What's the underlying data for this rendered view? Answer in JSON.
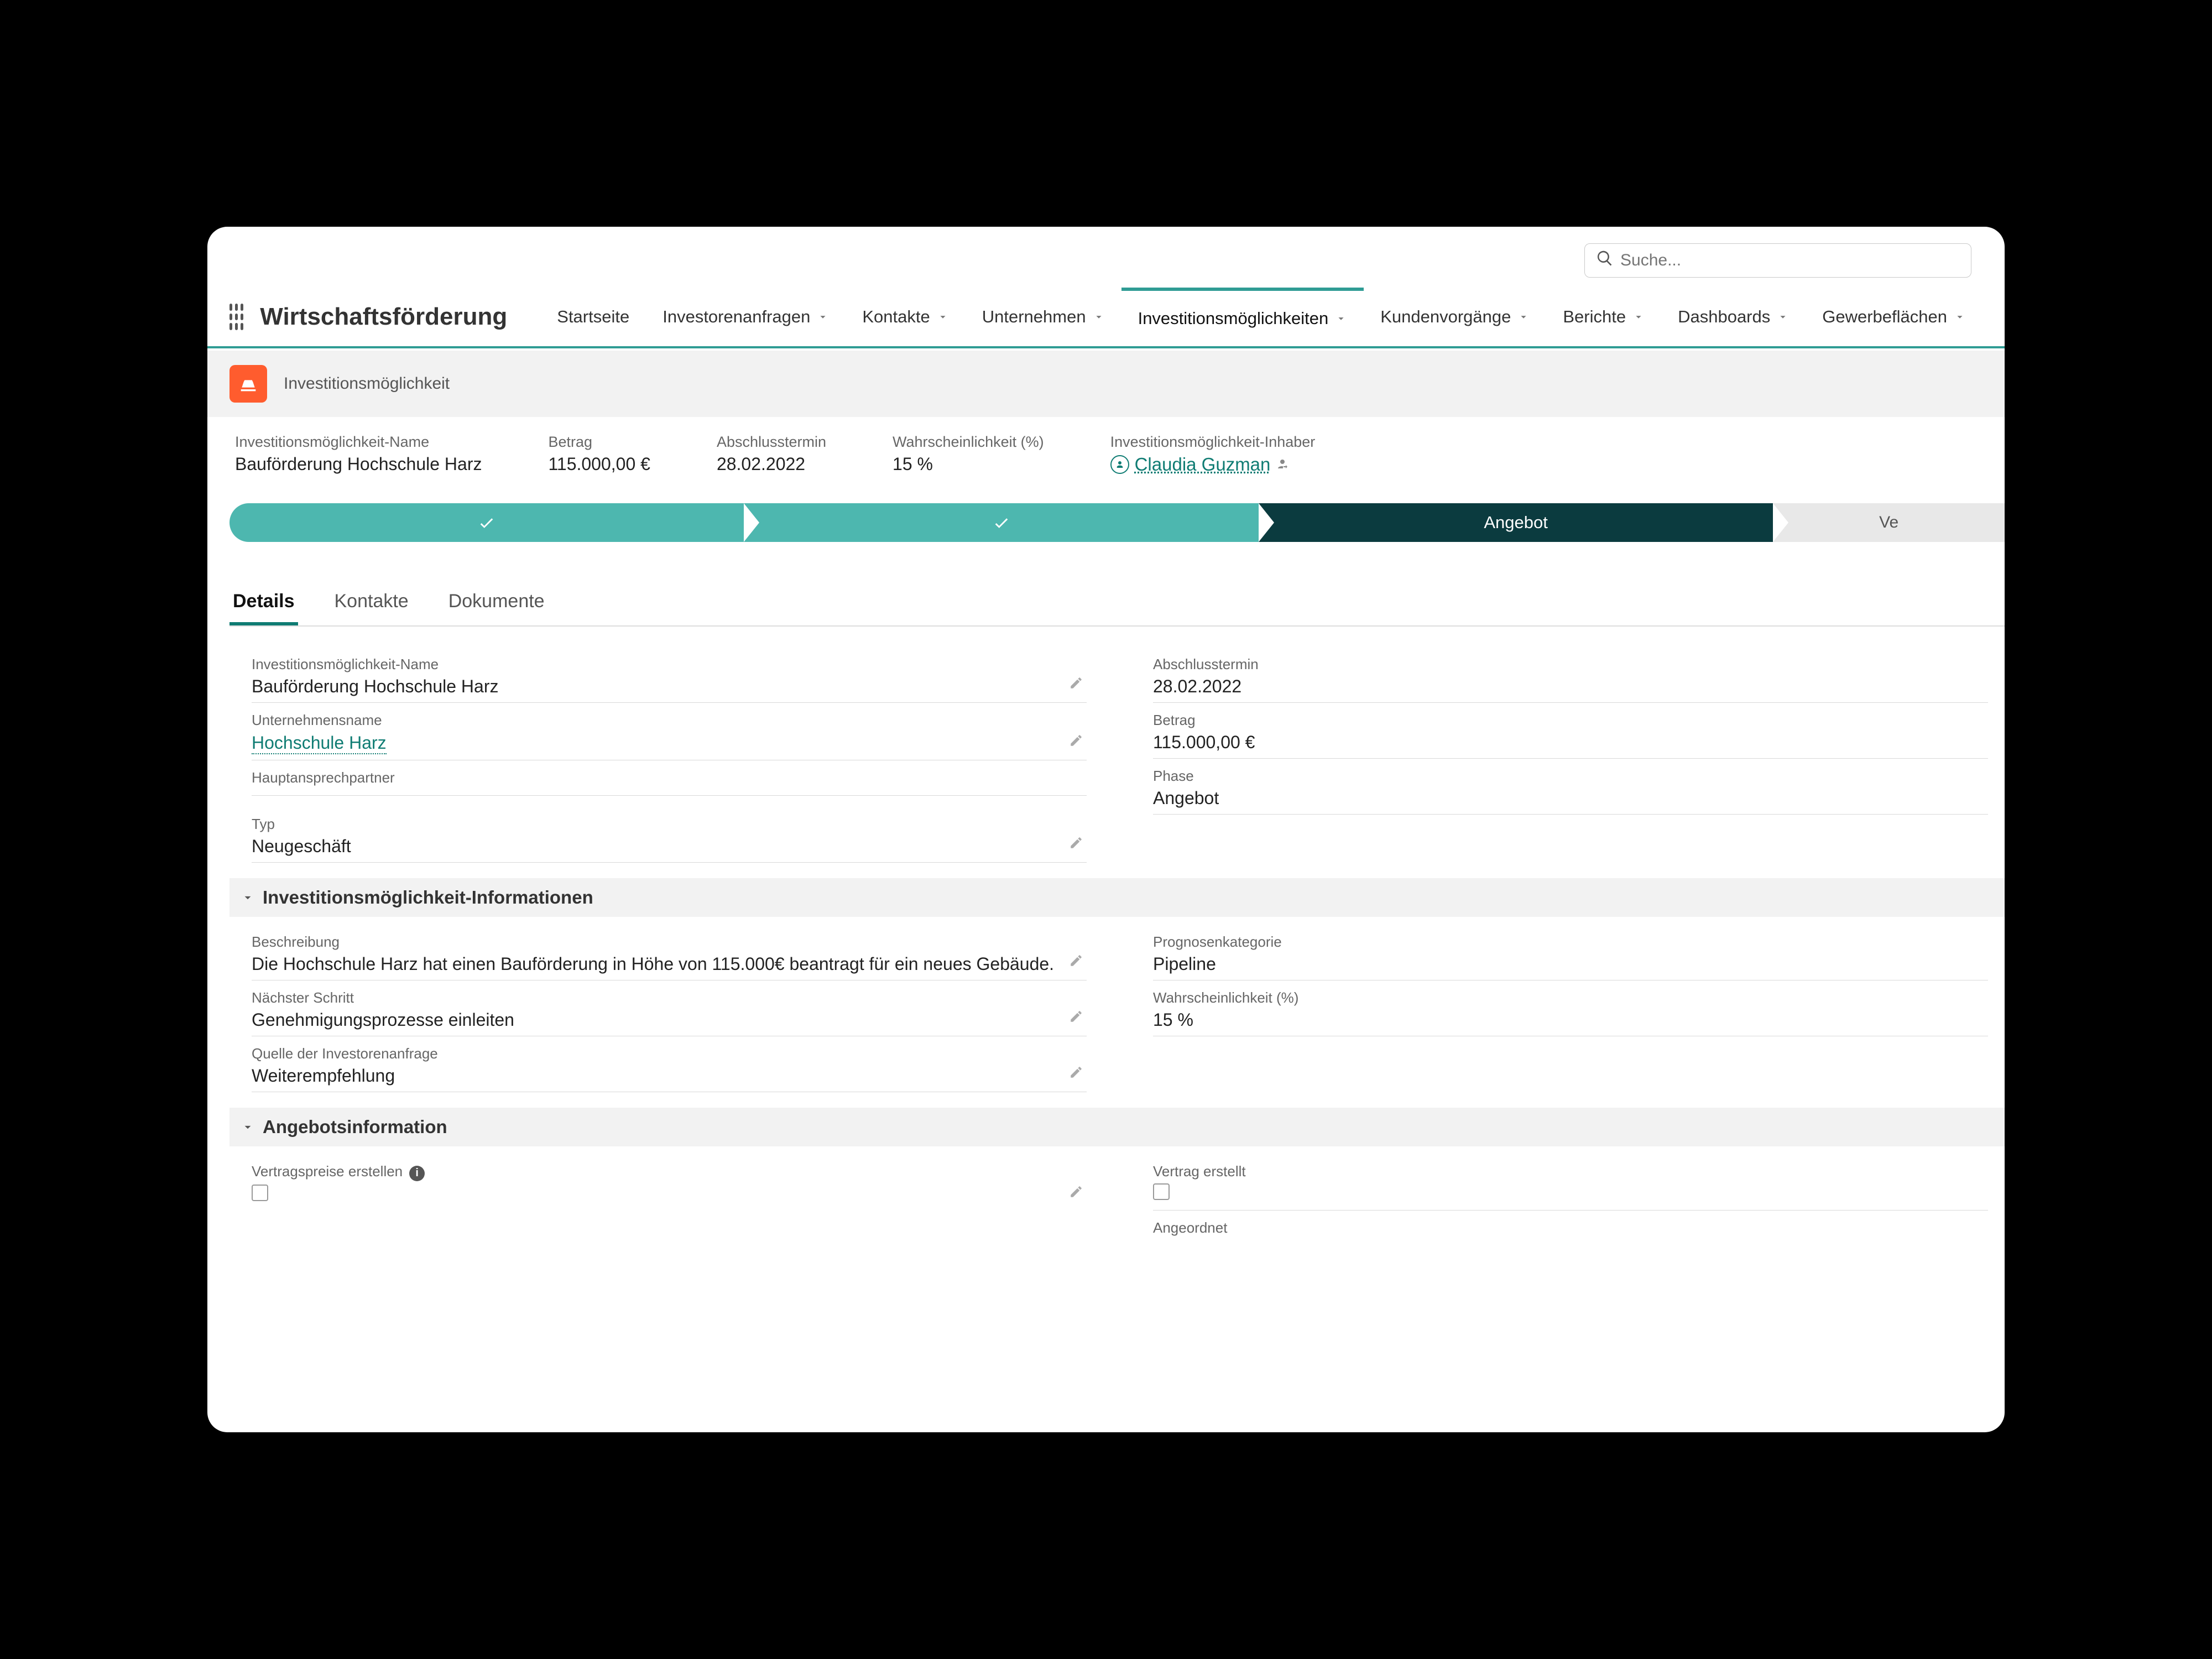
{
  "search": {
    "placeholder": "Suche..."
  },
  "app_name": "Wirtschaftsförderung",
  "nav": [
    {
      "label": "Startseite",
      "has_dropdown": false
    },
    {
      "label": "Investorenanfragen",
      "has_dropdown": true
    },
    {
      "label": "Kontakte",
      "has_dropdown": true
    },
    {
      "label": "Unternehmen",
      "has_dropdown": true
    },
    {
      "label": "Investitionsmöglichkeiten",
      "has_dropdown": true,
      "active": true
    },
    {
      "label": "Kundenvorgänge",
      "has_dropdown": true
    },
    {
      "label": "Berichte",
      "has_dropdown": true
    },
    {
      "label": "Dashboards",
      "has_dropdown": true
    },
    {
      "label": "Gewerbeflächen",
      "has_dropdown": true
    }
  ],
  "record": {
    "type_label": "Investitionsmöglichkeit"
  },
  "summary": {
    "name_label": "Investitionsmöglichkeit-Name",
    "name_value": "Bauförderung Hochschule Harz",
    "amount_label": "Betrag",
    "amount_value": "115.000,00 €",
    "close_label": "Abschlusstermin",
    "close_value": "28.02.2022",
    "prob_label": "Wahrscheinlichkeit (%)",
    "prob_value": "15 %",
    "owner_label": "Investitionsmöglichkeit-Inhaber",
    "owner_value": "Claudia Guzman"
  },
  "path": {
    "current": "Angebot",
    "next_partial": "Ve"
  },
  "tabs": [
    {
      "label": "Details",
      "active": true
    },
    {
      "label": "Kontakte"
    },
    {
      "label": "Dokumente"
    }
  ],
  "details": {
    "left": {
      "name_label": "Investitionsmöglichkeit-Name",
      "name_value": "Bauförderung Hochschule Harz",
      "company_label": "Unternehmensname",
      "company_value": "Hochschule Harz",
      "contact_label": "Hauptansprechpartner",
      "contact_value": "",
      "type_label": "Typ",
      "type_value": "Neugeschäft"
    },
    "right": {
      "close_label": "Abschlusstermin",
      "close_value": "28.02.2022",
      "amount_label": "Betrag",
      "amount_value": "115.000,00 €",
      "phase_label": "Phase",
      "phase_value": "Angebot"
    },
    "section_info": "Investitionsmöglichkeit-Informationen",
    "info_left": {
      "desc_label": "Beschreibung",
      "desc_value": "Die Hochschule Harz hat einen Bauförderung in Höhe von 115.000€ beantragt für ein neues Gebäude.",
      "next_label": "Nächster Schritt",
      "next_value": "Genehmigungsprozesse einleiten",
      "source_label": "Quelle der Investorenanfrage",
      "source_value": "Weiterempfehlung"
    },
    "info_right": {
      "forecast_label": "Prognosenkategorie",
      "forecast_value": "Pipeline",
      "prob_label": "Wahrscheinlichkeit (%)",
      "prob_value": "15 %"
    },
    "section_offer": "Angebotsinformation",
    "offer_left": {
      "price_label": "Vertragspreise erstellen"
    },
    "offer_right": {
      "contract_label": "Vertrag erstellt",
      "ordered_label": "Angeordnet"
    }
  }
}
